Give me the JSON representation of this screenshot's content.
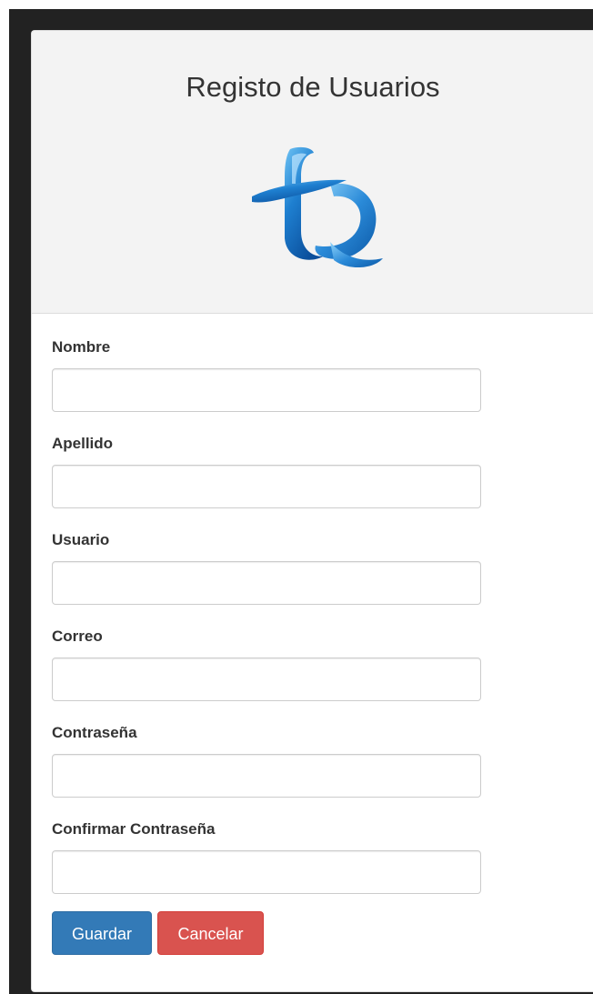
{
  "header": {
    "title": "Registo de Usuarios",
    "logo_icon": "tq-logo-icon"
  },
  "form": {
    "fields": [
      {
        "label": "Nombre",
        "value": "",
        "placeholder": ""
      },
      {
        "label": "Apellido",
        "value": "",
        "placeholder": ""
      },
      {
        "label": "Usuario",
        "value": "",
        "placeholder": ""
      },
      {
        "label": "Correo",
        "value": "",
        "placeholder": ""
      },
      {
        "label": "Contraseña",
        "value": "",
        "placeholder": ""
      },
      {
        "label": "Confirmar Contraseña",
        "value": "",
        "placeholder": ""
      }
    ]
  },
  "actions": {
    "save_label": "Guardar",
    "cancel_label": "Cancelar"
  },
  "colors": {
    "primary": "#337ab7",
    "danger": "#d9534f",
    "heading_bg": "#f3f3f3",
    "frame_dark": "#222222"
  }
}
